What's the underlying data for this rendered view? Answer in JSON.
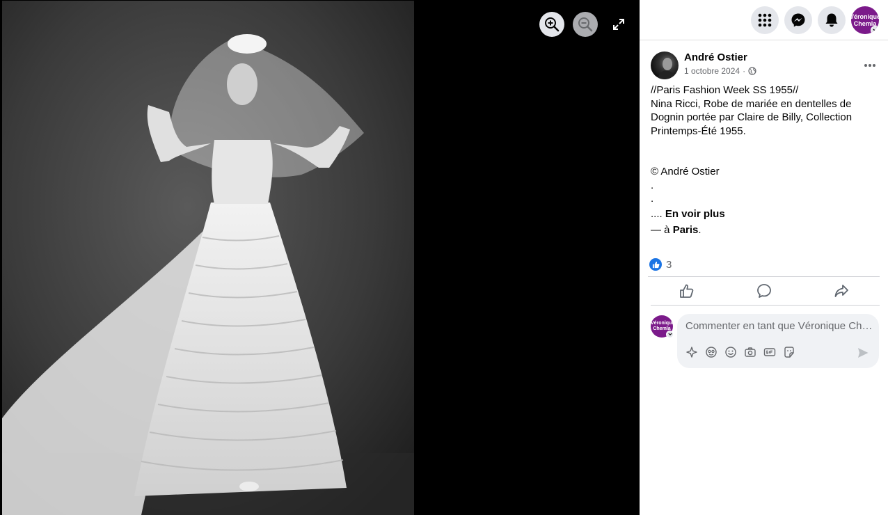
{
  "viewer": {
    "photo_alt": "Photo en noir et blanc d'une robe de mariée",
    "icons": [
      "zoom-in-icon",
      "zoom-out-icon",
      "fullscreen-icon"
    ]
  },
  "topbar": {
    "icons": [
      "menu-grid-icon",
      "messenger-icon",
      "bell-icon"
    ],
    "account_label_1": "Véronique",
    "account_label_2": "Chemla"
  },
  "post": {
    "author": "André Ostier",
    "date": "1 octobre 2024",
    "date_separator": "·",
    "privacy_icon": "globe-icon",
    "text_lines": [
      "//Paris Fashion Week SS 1955//",
      "Nina Ricci, Robe de mariée en dentelles de Dognin portée par Claire de Billy, Collection Printemps-Été 1955.",
      "",
      "",
      "© André Ostier",
      ".",
      "."
    ],
    "see_more_prefix": ".... ",
    "see_more": "En voir plus",
    "location_prefix": "— à ",
    "location": "Paris",
    "location_suffix": ".",
    "reaction_count": "3"
  },
  "comment": {
    "placeholder": "Commenter en tant que Véronique Chemla",
    "avatar_label_1": "Véronique",
    "avatar_label_2": "Chemla"
  },
  "colors": {
    "brand_blue": "#1b74e4",
    "account_purple": "#7b1a8a",
    "icon_bg": "#e4e6eb"
  }
}
